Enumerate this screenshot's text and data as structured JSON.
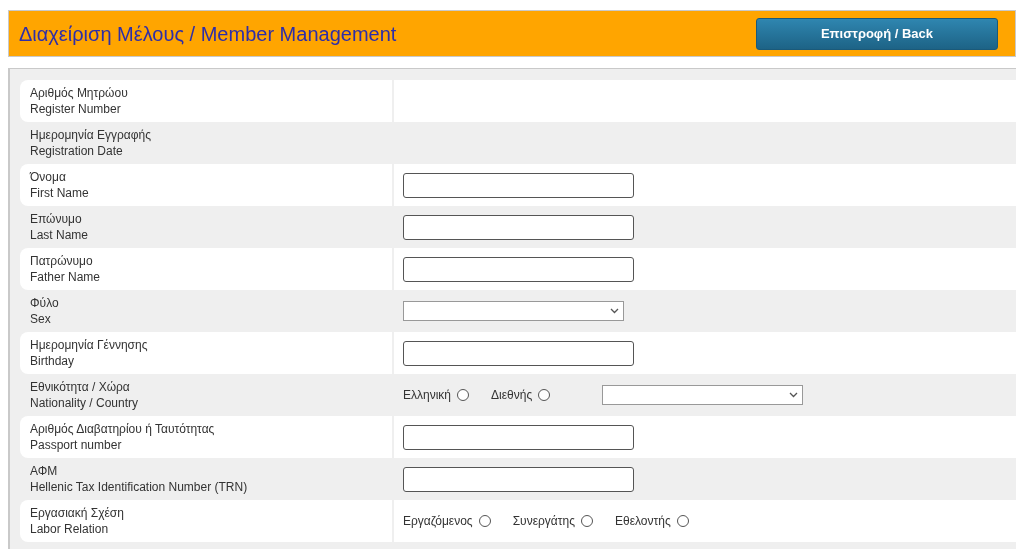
{
  "header": {
    "title": "Διαχείριση Μέλους / Member Management",
    "back_button": "Επιστροφή / Back"
  },
  "rows": [
    {
      "label_el": "Αριθμός Μητρώου",
      "label_en": "Register Number",
      "kind": "empty"
    },
    {
      "label_el": "Ημερομηνία Εγγραφής",
      "label_en": "Registration Date",
      "kind": "empty"
    },
    {
      "label_el": "Όνομα",
      "label_en": "First Name",
      "kind": "text"
    },
    {
      "label_el": "Επώνυμο",
      "label_en": "Last Name",
      "kind": "text"
    },
    {
      "label_el": "Πατρώνυμο",
      "label_en": "Father Name",
      "kind": "text"
    },
    {
      "label_el": "Φύλο",
      "label_en": "Sex",
      "kind": "select"
    },
    {
      "label_el": "Ημερομηνία Γέννησης",
      "label_en": "Birthday",
      "kind": "text"
    },
    {
      "label_el": "Εθνικότητα / Χώρα",
      "label_en": "Nationality / Country",
      "kind": "radios_select",
      "options": [
        {
          "label": "Ελληνική",
          "selected": false
        },
        {
          "label": "Διεθνής",
          "selected": false
        }
      ]
    },
    {
      "label_el": "Αριθμός Διαβατηρίου ή Ταυτότητας",
      "label_en": "Passport number",
      "kind": "text"
    },
    {
      "label_el": "ΑΦΜ",
      "label_en": "Hellenic Tax Identification Number (TRN)",
      "kind": "text"
    },
    {
      "label_el": "Εργασιακή Σχέση",
      "label_en": "Labor Relation",
      "kind": "radios",
      "options": [
        {
          "label": "Εργαζόμενος",
          "selected": false
        },
        {
          "label": "Συνεργάτης",
          "selected": false
        },
        {
          "label": "Εθελοντής",
          "selected": false
        }
      ]
    }
  ]
}
